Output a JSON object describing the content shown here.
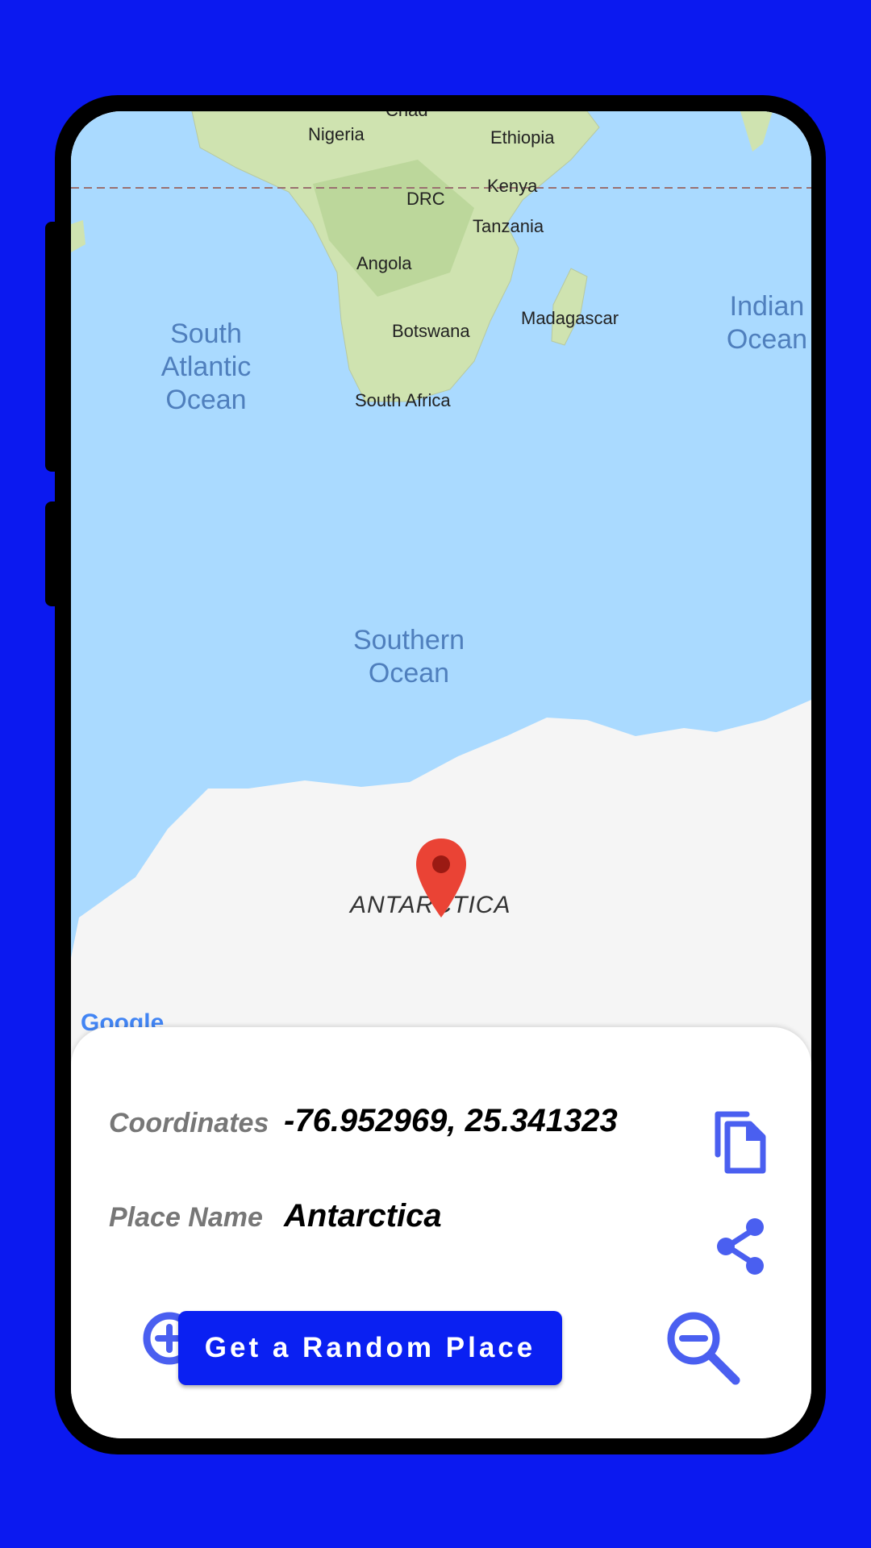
{
  "map": {
    "country_labels": [
      "Chad",
      "Nigeria",
      "Ethiopia",
      "DRC",
      "Kenya",
      "Tanzania",
      "Angola",
      "Madagascar",
      "Botswana",
      "South Africa"
    ],
    "ocean_labels": [
      "South\nAtlantic\nOcean",
      "Indian\nOcean",
      "Southern\nOcean"
    ],
    "continent_label": "ANTARCTICA",
    "attribution": "Google"
  },
  "info": {
    "coordinates_label": "Coordinates",
    "coordinates_value": "-76.952969, 25.341323",
    "place_label": "Place Name",
    "place_value": "Antarctica"
  },
  "actions": {
    "random_button": "Get a Random Place"
  },
  "colors": {
    "background": "#0b19f0",
    "accent": "#4a5ff0",
    "button": "#0a20f2",
    "ocean": "#aadaff",
    "ice": "#f5f5f5",
    "marker": "#ea4335"
  },
  "icons": [
    "copy-icon",
    "share-icon",
    "zoom-in-icon",
    "zoom-out-icon",
    "map-pin-icon"
  ]
}
